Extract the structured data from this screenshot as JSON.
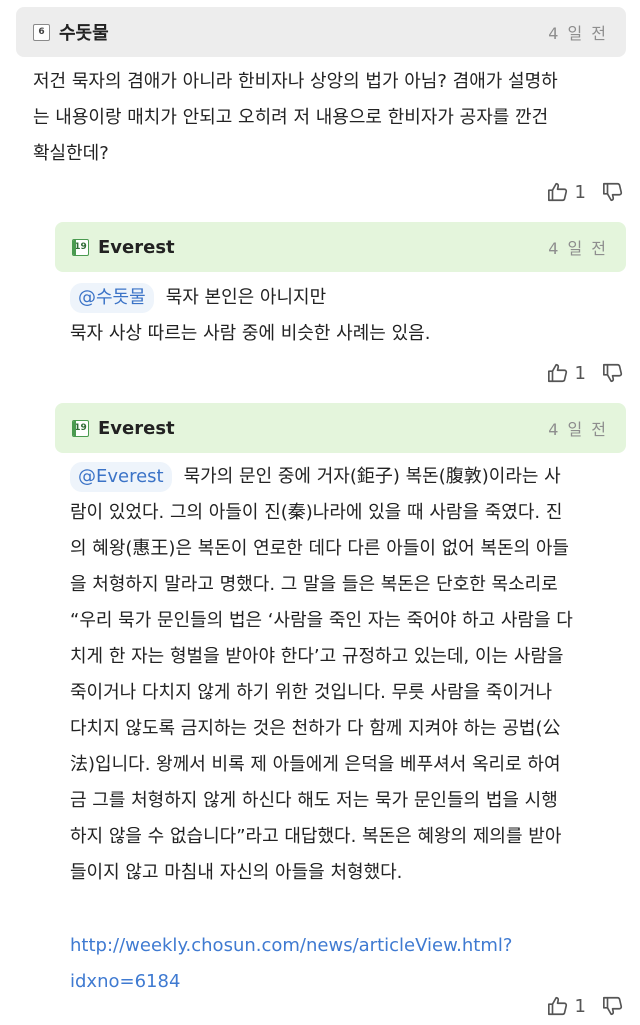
{
  "comments": [
    {
      "user": "수돗물",
      "level": "6",
      "time": "4 일 전",
      "lines": [
        "저건 묵자의 겸애가 아니라 한비자나 상앙의 법가 아님? 겸애가 설명하",
        "는 내용이랑 매치가 안되고 오히려 저 내용으로 한비자가 공자를 깐건",
        "확실한데?"
      ],
      "likes": "1",
      "like_icon": "thumbs-up-icon",
      "dislike_icon": "thumbs-down-icon"
    },
    {
      "user": "Everest",
      "level": "19",
      "time": "4 일 전",
      "mention": "@수돗물",
      "lines": [
        "묵자 본인은 아니지만",
        "묵자 사상 따르는 사람 중에 비슷한 사례는 있음."
      ],
      "likes": "1"
    },
    {
      "user": "Everest",
      "level": "19",
      "time": "4 일 전",
      "mention": "@Everest",
      "lines": [
        "묵가의 문인 중에 거자(鉅子) 복돈(腹敦)이라는 사",
        "람이 있었다. 그의 아들이 진(秦)나라에 있을 때 사람을 죽였다. 진",
        "의 혜왕(惠王)은 복돈이 연로한 데다 다른 아들이 없어 복돈의 아들",
        "을 처형하지 말라고 명했다. 그 말을 들은 복돈은 단호한 목소리로",
        "“우리 묵가 문인들의 법은 ‘사람을 죽인 자는 죽어야 하고 사람을 다",
        "치게 한 자는 형벌을 받아야 한다’고 규정하고 있는데, 이는 사람을",
        "죽이거나 다치지 않게 하기 위한 것입니다. 무릇 사람을 죽이거나",
        "다치지 않도록 금지하는 것은 천하가 다 함께 지켜야 하는 공법(公",
        "法)입니다. 왕께서 비록 제 아들에게 은덕을 베푸셔서 옥리로 하여",
        "금 그를 처형하지 않게 하신다 해도 저는 묵가 문인들의 법을 시행",
        "하지 않을 수 없습니다”라고 대답했다. 복돈은 혜왕의 제의를 받아",
        "들이지 않고 마침내 자신의 아들을 처형했다."
      ],
      "link_lines": [
        "http://weekly.chosun.com/news/articleView.html?",
        "idxno=6184"
      ],
      "likes": "1"
    }
  ],
  "colors": {
    "header_gray": "#ededed",
    "header_green": "#e4f5dc",
    "mention_text": "#3b73c7",
    "link": "#3f7ad1",
    "timestamp": "#8e8e8e"
  }
}
